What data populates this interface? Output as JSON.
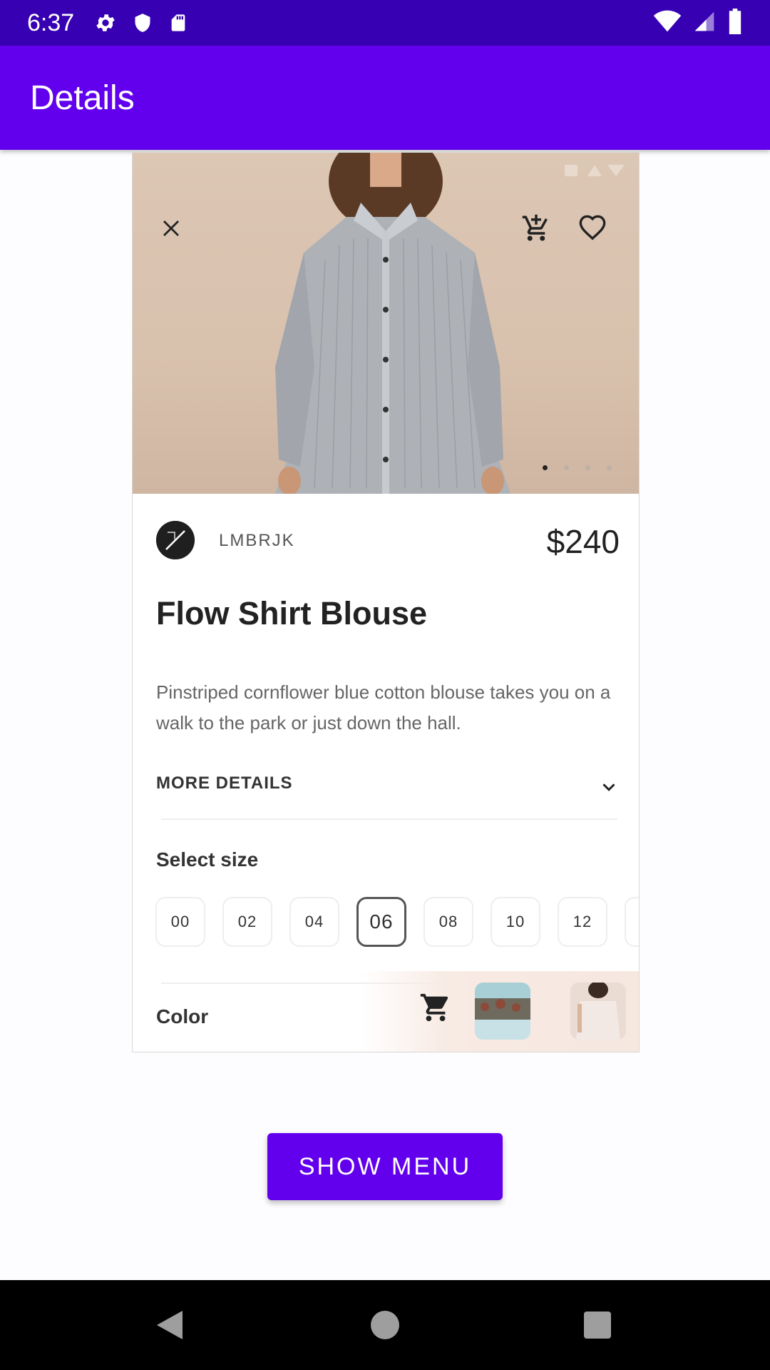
{
  "status_bar": {
    "time": "6:37"
  },
  "app_bar": {
    "title": "Details"
  },
  "product": {
    "brand": "LMBRJK",
    "price": "$240",
    "title": "Flow Shirt Blouse",
    "description": "Pinstriped cornflower blue cotton blouse takes you on a walk to the park or just down the hall.",
    "more_details_label": "MORE DETAILS",
    "select_size_label": "Select size",
    "sizes": [
      "00",
      "02",
      "04",
      "06",
      "08",
      "10",
      "12"
    ],
    "selected_size": "06",
    "color_label": "Color",
    "image_page_count": 4,
    "image_page_active": 1
  },
  "actions": {
    "show_menu_label": "SHOW MENU"
  },
  "colors": {
    "app_bar": "#6200ee",
    "status_bar": "#3700b3",
    "button": "#6200ee"
  }
}
